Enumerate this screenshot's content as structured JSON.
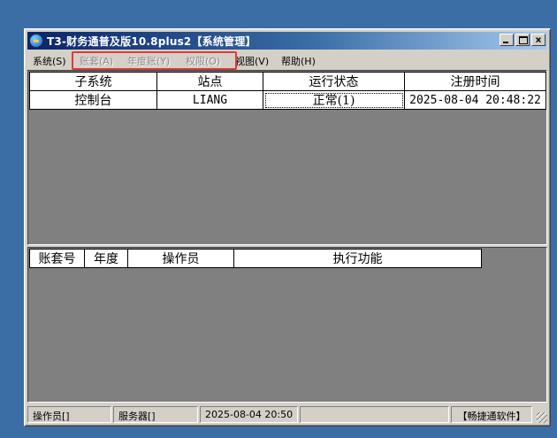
{
  "window": {
    "title": "T3-财务通普及版10.8plus2【系统管理】",
    "buttons": {
      "minimize": "_",
      "maximize": "□",
      "close": "×"
    }
  },
  "menubar": {
    "items": [
      {
        "label": "系统(S)",
        "enabled": true
      },
      {
        "label": "账套(A)",
        "enabled": false
      },
      {
        "label": "年度账(Y)",
        "enabled": false
      },
      {
        "label": "权限(O)",
        "enabled": false
      },
      {
        "label": "视图(V)",
        "enabled": true
      },
      {
        "label": "帮助(H)",
        "enabled": true
      }
    ],
    "highlight_color": "#e0393b"
  },
  "subsystem_table": {
    "headers": [
      "子系统",
      "站点",
      "运行状态",
      "注册时间"
    ],
    "rows": [
      [
        "控制台",
        "LIANG",
        "正常(1)",
        "2025-08-04 20:48:22"
      ]
    ]
  },
  "tasks_table": {
    "headers": [
      "账套号",
      "年度",
      "操作员",
      "执行功能"
    ]
  },
  "statusbar": {
    "operator": "操作员[]",
    "server": "服务器[]",
    "datetime": "2025-08-04 20:50",
    "empty": "",
    "brand": "【畅捷通软件】"
  },
  "colors": {
    "desktop": "#3a6ea5",
    "titlebar_start": "#0a246a",
    "titlebar_end": "#a6caf0",
    "pane_background": "#808080",
    "window_face": "#d4d0c8"
  }
}
